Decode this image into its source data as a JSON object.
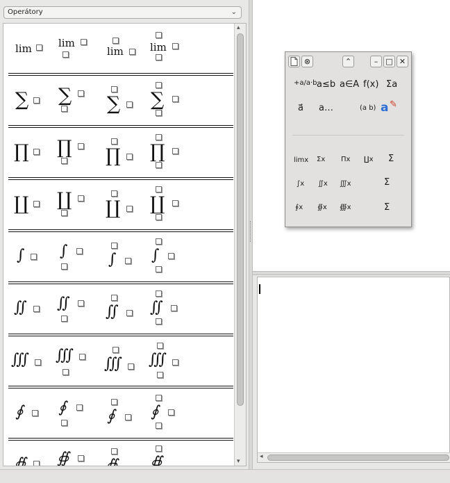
{
  "category_select": {
    "value": "Operátory"
  },
  "operators": {
    "lim": "lim",
    "sum": "∑",
    "prod": "∏",
    "coprod": "∐",
    "int": "∫",
    "iint": "∬",
    "iiint": "∭",
    "oint": "∮",
    "oiint": "∯"
  },
  "elements_window": {
    "toolbar": {
      "new_icon": "document-icon",
      "close_small": "⊗",
      "up": "⌃",
      "minimize": "–",
      "maximize": "□",
      "close": "✕"
    },
    "tools_row1": [
      "+a/a·b",
      "a≤b",
      "a∈A",
      "f(x)",
      "Σa"
    ],
    "tools_row2": [
      "a⃗",
      "a…",
      "(a b)",
      "✎"
    ],
    "tools_row3": [
      "limx",
      "Σx",
      "Πx",
      "∐x",
      "Σ"
    ],
    "tools_row4": [
      "∫x",
      "∬x",
      "∭x",
      "Σ"
    ],
    "tools_row5": [
      "∮x",
      "∯x",
      "∰x",
      "Σ"
    ],
    "tools_row2_b": "a",
    "colors": {
      "pen": "#2d6fd6"
    }
  },
  "editor": {
    "value": ""
  }
}
